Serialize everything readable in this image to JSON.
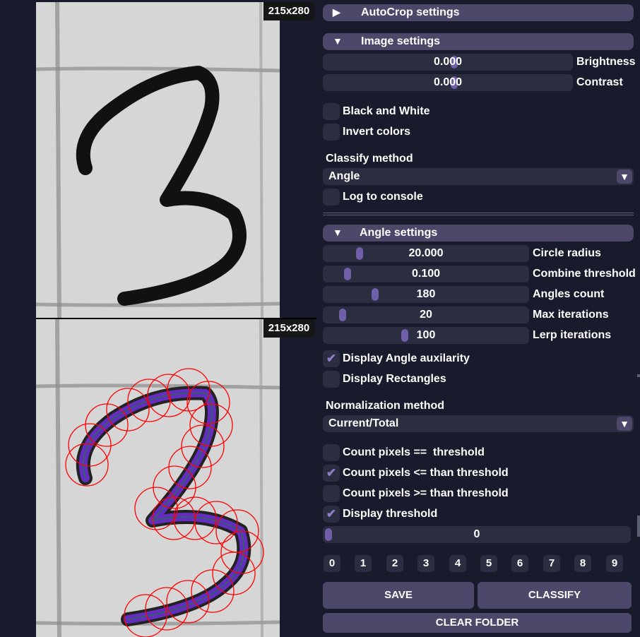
{
  "images": {
    "top_dim": "215x280",
    "bottom_dim": "215x280"
  },
  "panel": {
    "autocrop_header": "AutoCrop settings",
    "image_header": "Image settings",
    "brightness": {
      "value": "0.000",
      "label": "Brightness",
      "level": 0.5
    },
    "contrast": {
      "value": "0.000",
      "label": "Contrast",
      "level": 0.5
    },
    "black_white": {
      "label": "Black and White",
      "checked": false
    },
    "invert": {
      "label": "Invert colors",
      "checked": false
    },
    "classify_label": "Classify method",
    "classify_value": "Angle",
    "log_console": {
      "label": "Log to console",
      "checked": false
    },
    "angle_header": "Angle settings",
    "sliders": [
      {
        "value": "20.000",
        "label": "Circle radius",
        "level": 0.15
      },
      {
        "value": "0.100",
        "label": "Combine threshold",
        "level": 0.1
      },
      {
        "value": "180",
        "label": "Angles count",
        "level": 0.25
      },
      {
        "value": "20",
        "label": "Max iterations",
        "level": 0.05
      },
      {
        "value": "100",
        "label": "Lerp iterations",
        "level": 0.39
      }
    ],
    "display_angle": {
      "label": "Display Angle auxilarity",
      "checked": true
    },
    "display_rect": {
      "label": "Display Rectangles",
      "checked": false
    },
    "normalization_label": "Normalization method",
    "normalization_value": "Current/Total",
    "count_eq": {
      "label": "Count pixels ==  threshold",
      "checked": false
    },
    "count_le": {
      "label": "Count pixels <= than threshold",
      "checked": true
    },
    "count_ge": {
      "label": "Count pixels >= than threshold",
      "checked": false
    },
    "display_threshold": {
      "label": "Display threshold",
      "checked": true
    },
    "threshold_value": "0",
    "digits": [
      "0",
      "1",
      "2",
      "3",
      "4",
      "5",
      "6",
      "7",
      "8",
      "9"
    ],
    "save": "SAVE",
    "classify": "CLASSIFY",
    "clear_folder": "CLEAR FOLDER"
  },
  "icons": {
    "expand": "triangle-right-icon",
    "collapse": "triangle-down-icon",
    "check": "checkmark-icon",
    "combo_arrow": "chevron-down-icon"
  },
  "colors": {
    "background": "#171b2b",
    "header": "#4d4769",
    "frame": "#2a2e40",
    "grab": "#6f5fa8",
    "check": "#8d7ec8",
    "circle": "#ff0000",
    "stroke_overlay": "#6a2fd0"
  }
}
